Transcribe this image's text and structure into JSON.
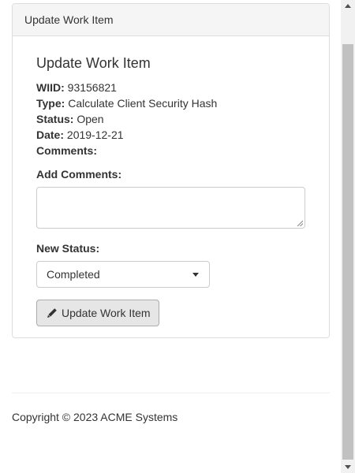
{
  "panel": {
    "heading": "Update Work Item"
  },
  "work_item": {
    "title": "Update Work Item",
    "wiid_label": "WIID:",
    "wiid_value": "93156821",
    "type_label": "Type:",
    "type_value": "Calculate Client Security Hash",
    "status_label": "Status:",
    "status_value": "Open",
    "date_label": "Date:",
    "date_value": "2019-12-21",
    "comments_label": "Comments:"
  },
  "form": {
    "add_comments_label": "Add Comments:",
    "comments_value": "",
    "new_status_label": "New Status:",
    "new_status_selected": "Completed",
    "submit_label": "Update Work Item",
    "submit_icon": "pencil-icon"
  },
  "footer": {
    "copyright": "Copyright © 2023 ACME Systems"
  },
  "colors": {
    "panel_heading_bg": "#f5f5f5",
    "border": "#dddddd",
    "button_bg": "#e6e6e6",
    "text": "#333333"
  }
}
